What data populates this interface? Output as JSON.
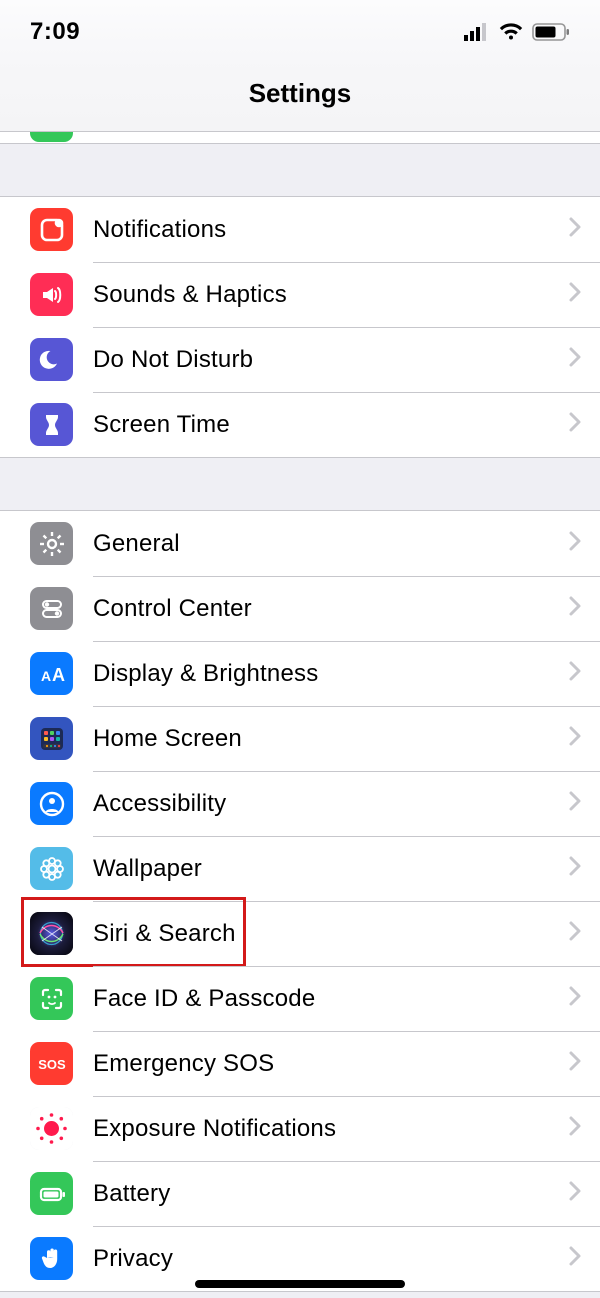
{
  "status": {
    "time": "7:09"
  },
  "nav": {
    "title": "Settings"
  },
  "sections": [
    {
      "rows": [
        {
          "id": "notifications",
          "label": "Notifications",
          "icon": "notifications-icon",
          "iconColor": "#ff3b30"
        },
        {
          "id": "sounds",
          "label": "Sounds & Haptics",
          "icon": "sounds-icon",
          "iconColor": "#ff2d55"
        },
        {
          "id": "dnd",
          "label": "Do Not Disturb",
          "icon": "moon-icon",
          "iconColor": "#5756d5"
        },
        {
          "id": "screentime",
          "label": "Screen Time",
          "icon": "hourglass-icon",
          "iconColor": "#5756d5"
        }
      ]
    },
    {
      "rows": [
        {
          "id": "general",
          "label": "General",
          "icon": "gear-icon",
          "iconColor": "#8e8e93"
        },
        {
          "id": "controlcenter",
          "label": "Control Center",
          "icon": "switches-icon",
          "iconColor": "#8e8e93"
        },
        {
          "id": "display",
          "label": "Display & Brightness",
          "icon": "aa-icon",
          "iconColor": "#0a7aff"
        },
        {
          "id": "homescreen",
          "label": "Home Screen",
          "icon": "grid-icon",
          "iconColor": "#3355bf"
        },
        {
          "id": "accessibility",
          "label": "Accessibility",
          "icon": "person-circle-icon",
          "iconColor": "#0a7aff"
        },
        {
          "id": "wallpaper",
          "label": "Wallpaper",
          "icon": "flower-icon",
          "iconColor": "#54bce8"
        },
        {
          "id": "siri",
          "label": "Siri & Search",
          "icon": "siri-icon",
          "iconColor": "#1a1a2b",
          "highlighted": true
        },
        {
          "id": "faceid",
          "label": "Face ID & Passcode",
          "icon": "face-icon",
          "iconColor": "#34c759"
        },
        {
          "id": "sos",
          "label": "Emergency SOS",
          "icon": "sos-icon",
          "iconColor": "#ff3b30"
        },
        {
          "id": "exposure",
          "label": "Exposure Notifications",
          "icon": "exposure-icon",
          "iconColor": "#ffffff"
        },
        {
          "id": "battery",
          "label": "Battery",
          "icon": "battery-icon",
          "iconColor": "#34c759"
        },
        {
          "id": "privacy",
          "label": "Privacy",
          "icon": "hand-icon",
          "iconColor": "#0a7aff"
        }
      ]
    }
  ]
}
